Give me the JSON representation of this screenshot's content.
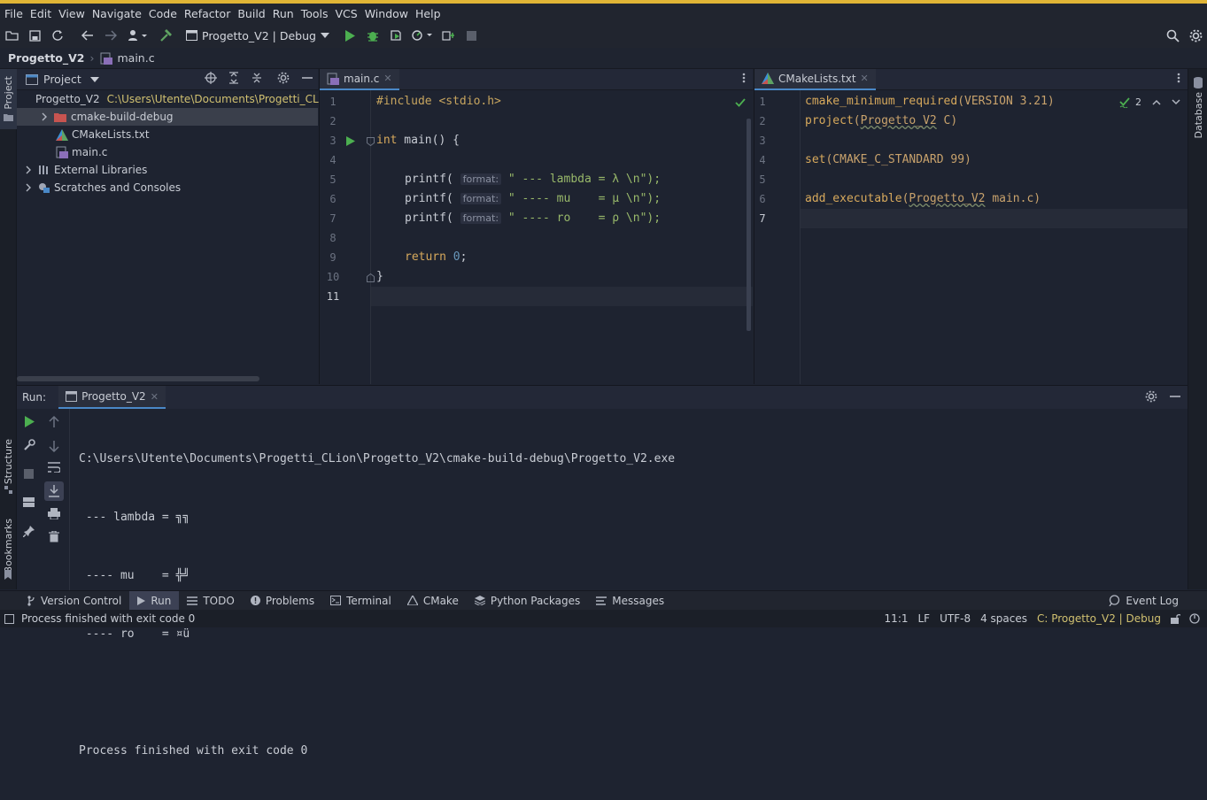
{
  "menu": [
    "File",
    "Edit",
    "View",
    "Navigate",
    "Code",
    "Refactor",
    "Build",
    "Run",
    "Tools",
    "VCS",
    "Window",
    "Help"
  ],
  "toolbar": {
    "run_config": "Progetto_V2 | Debug"
  },
  "breadcrumb": {
    "project": "Progetto_V2",
    "file": "main.c"
  },
  "left_strip": {
    "project": "Project",
    "structure": "Structure",
    "bookmarks": "Bookmarks"
  },
  "right_strip": {
    "database": "Database"
  },
  "project_panel": {
    "title": "Project",
    "root": "Progetto_V2",
    "root_path": "C:\\Users\\Utente\\Documents\\Progetti_CLion",
    "items": [
      "cmake-build-debug",
      "CMakeLists.txt",
      "main.c",
      "External Libraries",
      "Scratches and Consoles"
    ]
  },
  "editor_main": {
    "tab": "main.c",
    "line_numbers": [
      "1",
      "2",
      "3",
      "4",
      "5",
      "6",
      "7",
      "8",
      "9",
      "10",
      "11"
    ],
    "include": "#include <stdio.h>",
    "int_kw": "int",
    "main_sig": " main() {",
    "printf": "printf(",
    "hint": "format:",
    "s1": " \" --- lambda = λ \\n\");",
    "s2": " \" ---- mu    = μ \\n\");",
    "s3": " \" ---- ro    = ρ \\n\");",
    "return_kw": "return",
    "return_val": "0",
    "close": "}"
  },
  "editor_cmake": {
    "tab": "CMakeLists.txt",
    "line_numbers": [
      "1",
      "2",
      "3",
      "4",
      "5",
      "6",
      "7"
    ],
    "inspections": "2",
    "l1_cmd": "cmake_minimum_required",
    "l1_arg": "(VERSION 3.21)",
    "l2_cmd": "project",
    "l2_open": "(",
    "l2_name": "Progetto_V2",
    "l2_rest": " C)",
    "l4_cmd": "set",
    "l4_arg": "(CMAKE_C_STANDARD 99)",
    "l6_cmd": "add_executable",
    "l6_open": "(",
    "l6_name": "Progetto_V2",
    "l6_rest": " main.c)"
  },
  "run_panel": {
    "label": "Run:",
    "tab": "Progetto_V2",
    "lines": [
      "C:\\Users\\Utente\\Documents\\Progetti_CLion\\Progetto_V2\\cmake-build-debug\\Progetto_V2.exe",
      " --- lambda = ╗╗",
      " ---- mu    = ╬╝",
      " ---- ro    = ¤ü",
      "",
      "Process finished with exit code 0"
    ]
  },
  "bottom_tabs": [
    "Version Control",
    "Run",
    "TODO",
    "Problems",
    "Terminal",
    "CMake",
    "Python Packages",
    "Messages"
  ],
  "event_log": "Event Log",
  "status": {
    "message": "Process finished with exit code 0",
    "position": "11:1",
    "line_sep": "LF",
    "encoding": "UTF-8",
    "indent": "4 spaces",
    "context": "C: Progetto_V2 | Debug"
  }
}
